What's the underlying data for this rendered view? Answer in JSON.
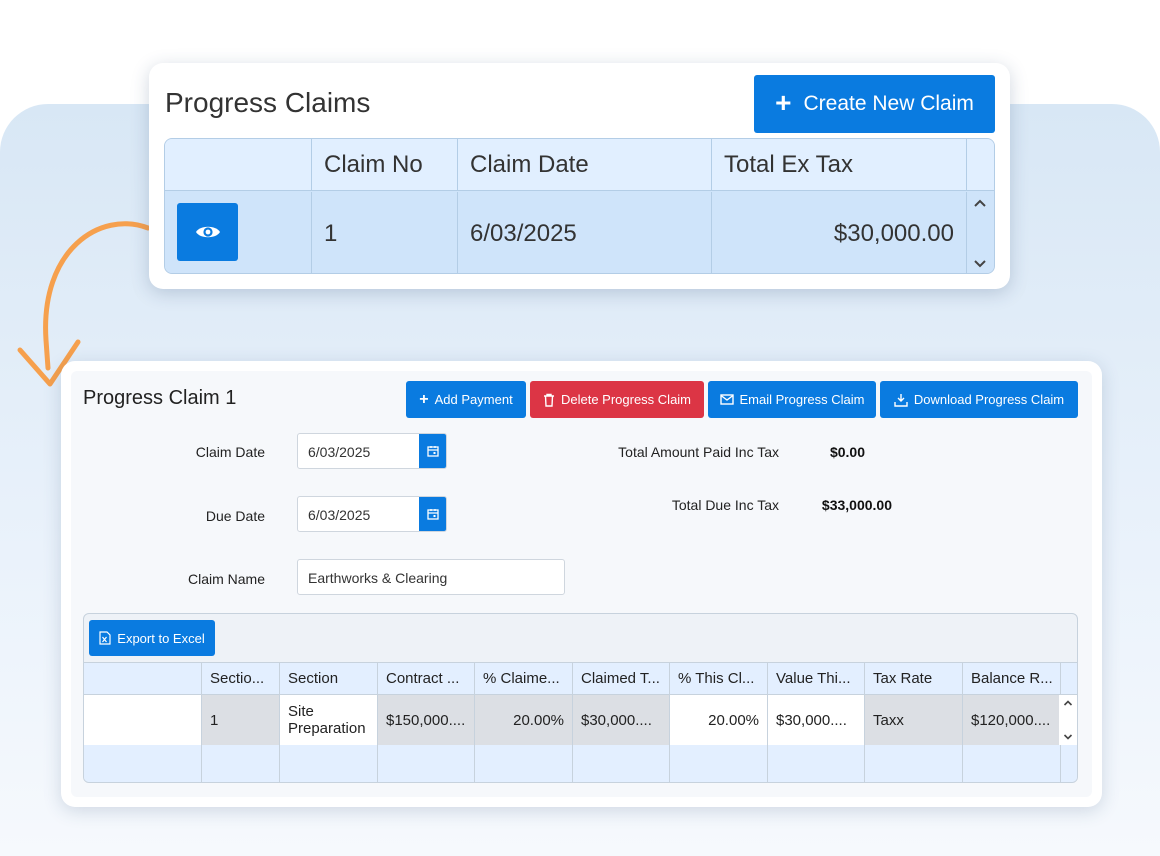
{
  "claims_list": {
    "title": "Progress Claims",
    "create_button": "Create New Claim",
    "columns": [
      "Claim No",
      "Claim Date",
      "Total Ex Tax"
    ],
    "rows": [
      {
        "claim_no": "1",
        "claim_date": "6/03/2025",
        "total_ex_tax": "$30,000.00"
      }
    ]
  },
  "claim_detail": {
    "title": "Progress Claim 1",
    "toolbar": {
      "add_payment": "Add Payment",
      "delete": "Delete Progress Claim",
      "email": "Email Progress Claim",
      "download": "Download Progress Claim"
    },
    "form": {
      "claim_date_label": "Claim Date",
      "claim_date_value": "6/03/2025",
      "due_date_label": "Due Date",
      "due_date_value": "6/03/2025",
      "claim_name_label": "Claim Name",
      "claim_name_value": "Earthworks & Clearing"
    },
    "totals": {
      "paid_label": "Total Amount Paid Inc Tax",
      "paid_value": "$0.00",
      "due_label": "Total Due Inc Tax",
      "due_value": "$33,000.00"
    },
    "grid": {
      "export_button": "Export to Excel",
      "columns": [
        "Sectio...",
        "Section",
        "Contract ...",
        "% Claime...",
        "Claimed T...",
        "% This Cl...",
        "Value Thi...",
        "Tax Rate",
        "Balance R..."
      ],
      "rows": [
        [
          "1",
          "Site Preparation",
          "$150,000....",
          "20.00%",
          "$30,000....",
          "20.00%",
          "$30,000....",
          "Taxx",
          "$120,000...."
        ]
      ]
    }
  },
  "colors": {
    "primary": "#0a7be0",
    "danger": "#dc3545",
    "arrow": "#f6a04d"
  }
}
